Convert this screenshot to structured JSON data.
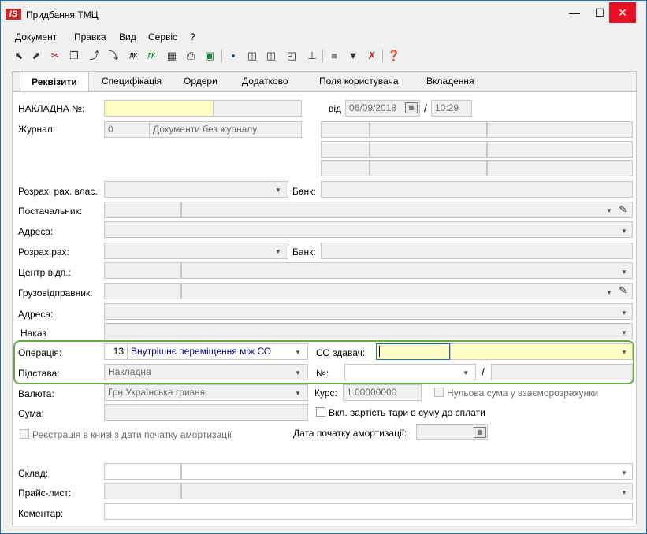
{
  "window": {
    "title": "Придбання ТМЦ",
    "app_icon_text": "IS",
    "min": "—",
    "max": "☐",
    "close": "✕"
  },
  "menu": [
    "Документ",
    "Правка",
    "Вид",
    "Сервіс",
    "?"
  ],
  "toolbar_icons": [
    "copy-icon",
    "paste-icon",
    "delete-icon",
    "duplicate-icon",
    "export-icon",
    "import-icon",
    "dk-icon",
    "dk-colored-icon",
    "grid-icon",
    "print-icon",
    "excel-icon",
    "save-icon",
    "columns-icon",
    "columns2-icon",
    "chart-icon",
    "tree-icon",
    "stop-icon",
    "filter-icon",
    "clear-filter-icon",
    "help-icon"
  ],
  "toolbar": {
    "dk1": "ДК",
    "dk2": "ДК"
  },
  "tabs": [
    "Реквізити",
    "Специфікація",
    "Ордери",
    "Додатково",
    "Поля користувача",
    "Вкладення"
  ],
  "labels": {
    "invoice_no": "НАКЛАДНА №:",
    "journal": "Журнал:",
    "from": "від",
    "slash": "/",
    "settlement_own": "Розрах. рах. влас.",
    "bank": "Банк:",
    "supplier": "Постачальник:",
    "address": "Адреса:",
    "settlement": "Розрах.рах:",
    "resp_center": "Центр відп.:",
    "shipper": "Грузовідправник:",
    "order": "Наказ",
    "operation": "Операція:",
    "co_sender": "СО здавач:",
    "basis": "Підстава:",
    "number": "№:",
    "currency": "Валюта:",
    "rate": "Курс:",
    "zero_sum": "Нульова сума у взаєморозрахунки",
    "amount": "Сума:",
    "incl_tare": "Вкл. вартість тари в суму до сплати",
    "register": "Реєстрація в книзі з дати початку амортизації",
    "amort_start": "Дата початку амортизації:",
    "warehouse": "Склад:",
    "price_list": "Прайс-лист:",
    "comment": "Коментар:"
  },
  "values": {
    "date": "06/09/2018",
    "time": "10:29",
    "journal_code": "0",
    "journal_name": "Документи без журналу",
    "operation_code": "13",
    "operation_name": "Внутрішнє переміщення між СО",
    "basis": "Накладна",
    "currency": "Грн Українська гривня",
    "rate": "1.00000000"
  },
  "accent_colors": {
    "highlight": "#6aab41",
    "required_field": "#ffffc6",
    "close_button": "#e81123"
  }
}
